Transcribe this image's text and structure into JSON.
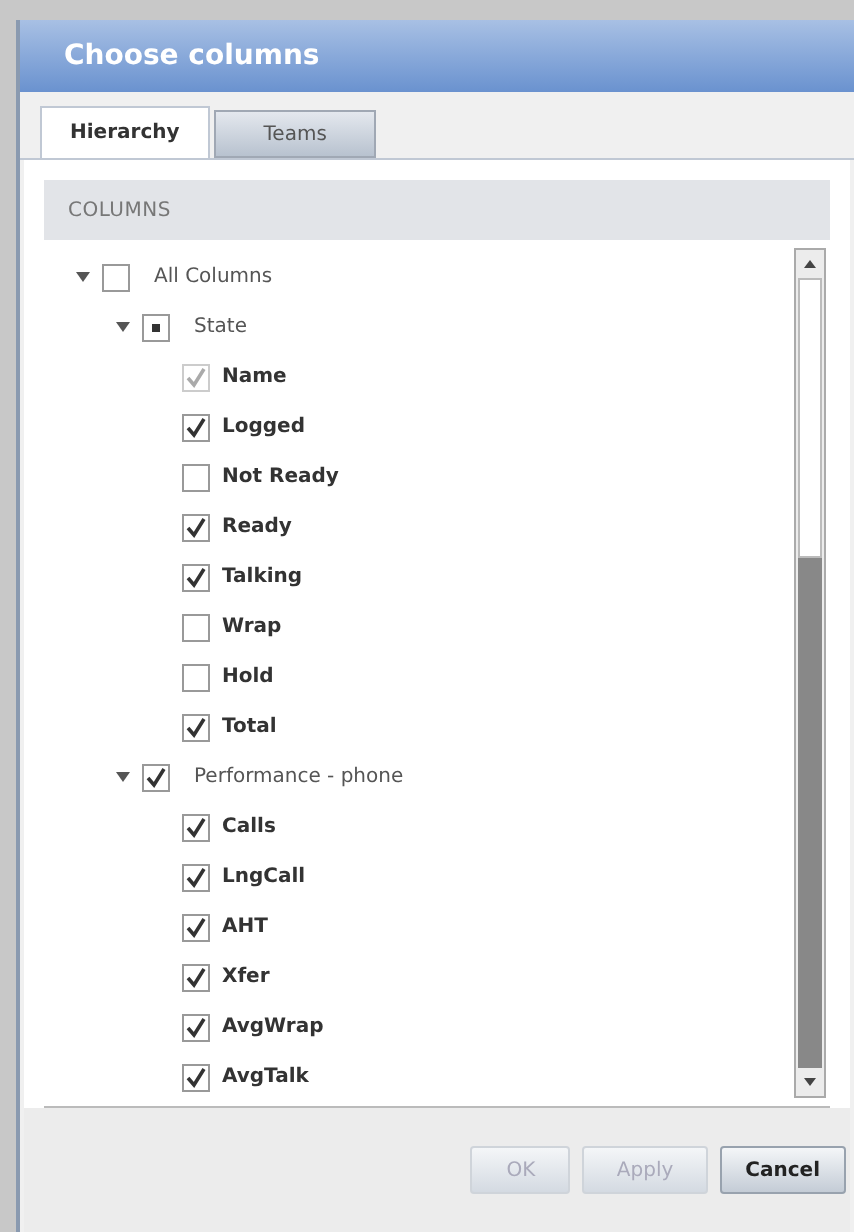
{
  "window": {
    "title": "Choose columns"
  },
  "tabs": [
    {
      "label": "Hierarchy",
      "selected": true
    },
    {
      "label": "Teams",
      "selected": false
    }
  ],
  "columns_header": "COLUMNS",
  "tree": [
    {
      "label": "All Columns",
      "expanded": true,
      "checked": false,
      "partial": false,
      "disabled": false,
      "children": [
        {
          "label": "State",
          "expanded": true,
          "partial": true,
          "disabled": false,
          "children": [
            {
              "label": "Name",
              "checked": true,
              "partial": false,
              "disabled": true
            },
            {
              "label": "Logged",
              "checked": true,
              "partial": false,
              "disabled": false
            },
            {
              "label": "Not Ready",
              "checked": false,
              "partial": false,
              "disabled": false
            },
            {
              "label": "Ready",
              "checked": true,
              "partial": false,
              "disabled": false
            },
            {
              "label": "Talking",
              "checked": true,
              "partial": false,
              "disabled": false
            },
            {
              "label": "Wrap",
              "checked": false,
              "partial": false,
              "disabled": false
            },
            {
              "label": "Hold",
              "checked": false,
              "partial": false,
              "disabled": false
            },
            {
              "label": "Total",
              "checked": true,
              "partial": false,
              "disabled": false
            }
          ]
        },
        {
          "label": "Performance - phone",
          "expanded": true,
          "checked": true,
          "partial": false,
          "disabled": false,
          "children": [
            {
              "label": "Calls",
              "checked": true,
              "partial": false,
              "disabled": false
            },
            {
              "label": "LngCall",
              "checked": true,
              "partial": false,
              "disabled": false
            },
            {
              "label": "AHT",
              "checked": true,
              "partial": false,
              "disabled": false
            },
            {
              "label": "Xfer",
              "checked": true,
              "partial": false,
              "disabled": false
            },
            {
              "label": "AvgWrap",
              "checked": true,
              "partial": false,
              "disabled": false
            },
            {
              "label": "AvgTalk",
              "checked": true,
              "partial": false,
              "disabled": false
            }
          ]
        }
      ]
    }
  ],
  "buttons": [
    {
      "label": "OK",
      "disabled": true
    },
    {
      "label": "Apply",
      "disabled": true
    },
    {
      "label": "Cancel",
      "disabled": false
    }
  ]
}
